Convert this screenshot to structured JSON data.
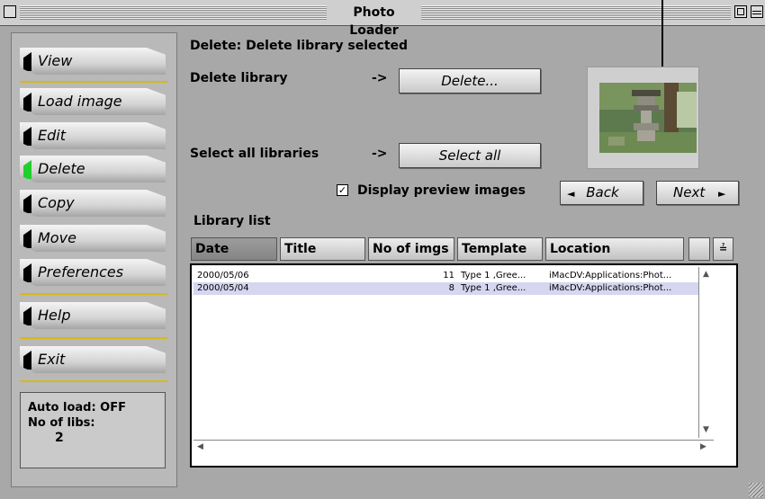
{
  "window": {
    "title": "Photo Loader"
  },
  "sidebar": {
    "buttons": [
      {
        "label": "View"
      },
      {
        "label": "Load image"
      },
      {
        "label": "Edit"
      },
      {
        "label": "Delete",
        "active": true
      },
      {
        "label": "Copy"
      },
      {
        "label": "Move"
      },
      {
        "label": "Preferences"
      },
      {
        "label": "Help"
      },
      {
        "label": "Exit"
      }
    ],
    "status": {
      "auto_load": "Auto load: OFF",
      "libs_label": "No of libs:",
      "libs_count": "2"
    }
  },
  "main": {
    "heading": "Delete: Delete library selected",
    "delete_row": {
      "label": "Delete library",
      "arrow": "->",
      "button": "Delete..."
    },
    "select_row": {
      "label": "Select all libraries",
      "arrow": "->",
      "button": "Select all"
    },
    "preview_checkbox": {
      "label": "Display preview images",
      "checked": true,
      "mark": "✓"
    },
    "nav": {
      "back": "Back",
      "next": "Next",
      "back_icon": "◄",
      "next_icon": "►"
    },
    "library_list_label": "Library list",
    "columns": [
      "Date",
      "Title",
      "No of imgs",
      "Template",
      "Location"
    ],
    "sort_icon": "≟",
    "rows": [
      {
        "date": "2000/05/06",
        "title": "",
        "count": "11",
        "template": "Type 1 ,Gree...",
        "location": "iMacDV:Applications:Phot..."
      },
      {
        "date": "2000/05/04",
        "title": "",
        "count": "8",
        "template": "Type 1 ,Gree...",
        "location": "iMacDV:Applications:Phot...",
        "selected": true
      }
    ]
  },
  "colors": {
    "active_mark": "#1fd02d",
    "separator": "#d6b81a",
    "selection": "#d6d6f0"
  }
}
